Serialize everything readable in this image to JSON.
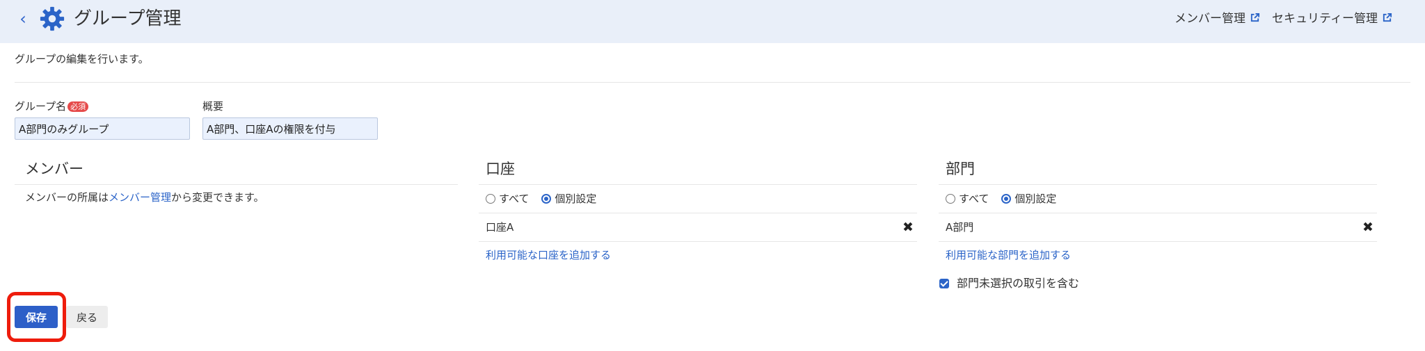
{
  "header": {
    "title": "グループ管理",
    "member_link": "メンバー管理",
    "security_link": "セキュリティー管理"
  },
  "description": "グループの編集を行います。",
  "form": {
    "group_name_label": "グループ名",
    "required_badge": "必須",
    "group_name_value": "A部門のみグループ",
    "summary_label": "概要",
    "summary_value": "A部門、口座Aの権限を付与"
  },
  "members": {
    "title": "メンバー",
    "text_before": "メンバーの所属は",
    "link": "メンバー管理",
    "text_after": "から変更できます。"
  },
  "accounts": {
    "title": "口座",
    "option_all": "すべて",
    "option_individual": "個別設定",
    "selected": "individual",
    "items": [
      "口座A"
    ],
    "add_link": "利用可能な口座を追加する"
  },
  "departments": {
    "title": "部門",
    "option_all": "すべて",
    "option_individual": "個別設定",
    "selected": "individual",
    "items": [
      "A部門"
    ],
    "add_link": "利用可能な部門を追加する",
    "include_unselected_label": "部門未選択の取引を含む",
    "include_unselected_checked": true
  },
  "actions": {
    "save": "保存",
    "back": "戻る"
  },
  "colors": {
    "header_bg": "#e9eff9",
    "accent": "#2b64c8",
    "save_button": "#2d5fc8",
    "highlight_border": "#ee1c0c",
    "required_badge": "#e54a4a"
  },
  "icons": {
    "back": "chevron-left-icon",
    "title": "gear-icon",
    "external": "external-link-icon",
    "remove": "close-icon"
  }
}
